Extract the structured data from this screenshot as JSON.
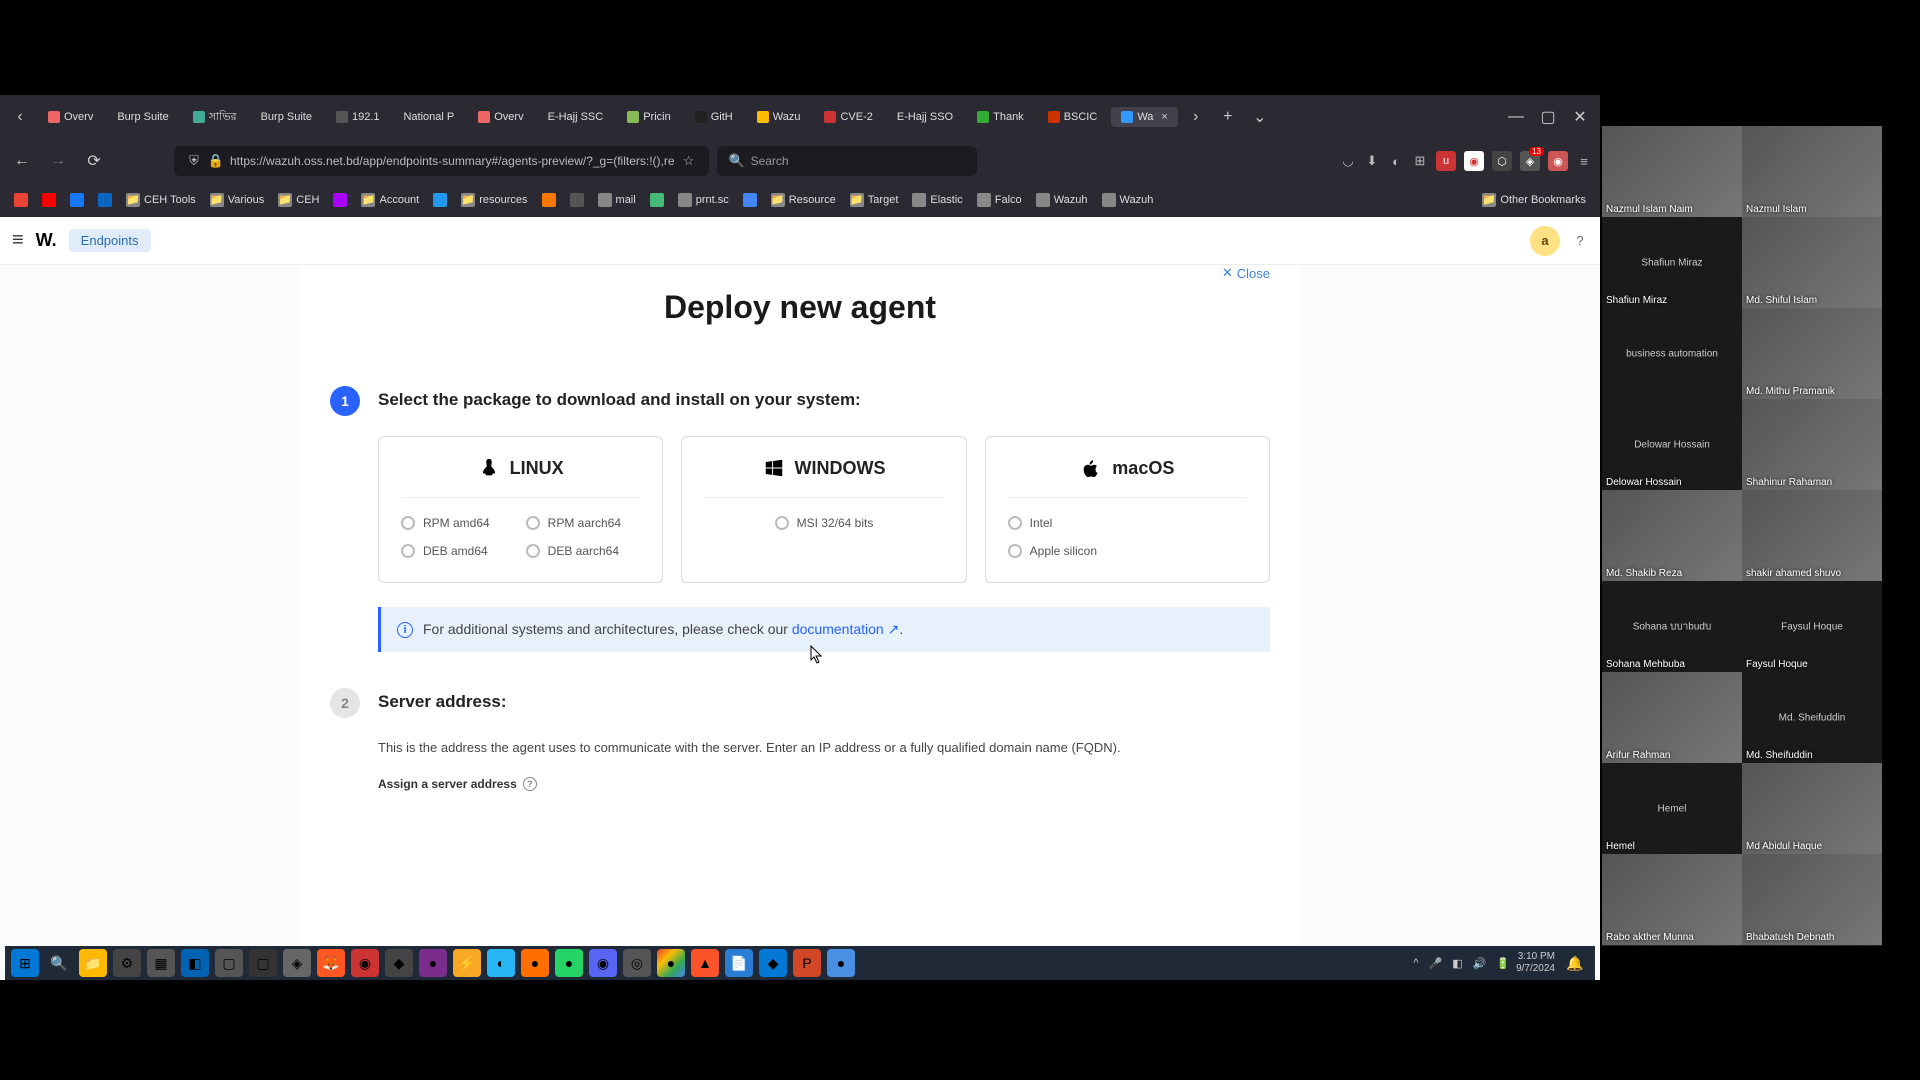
{
  "browser": {
    "tabs": [
      {
        "label": "Overv"
      },
      {
        "label": "Burp Suite"
      },
      {
        "label": "সাভির"
      },
      {
        "label": "Burp Suite"
      },
      {
        "label": "192.1"
      },
      {
        "label": "National P"
      },
      {
        "label": "Overv"
      },
      {
        "label": "E-Hajj SSC"
      },
      {
        "label": "Pricin"
      },
      {
        "label": "GitH"
      },
      {
        "label": "Wazu"
      },
      {
        "label": "CVE-2"
      },
      {
        "label": "E-Hajj SSO"
      },
      {
        "label": "Thank"
      },
      {
        "label": "BSCIC"
      },
      {
        "label": "Wa"
      }
    ],
    "url": "https://wazuh.oss.net.bd/app/endpoints-summary#/agents-preview/?_g=(filters:!(),re",
    "search_placeholder": "Search",
    "bookmarks": [
      "CEH Tools",
      "Various",
      "CEH",
      "Account",
      "resources",
      "mail",
      "prnt.sc",
      "Resource",
      "Target",
      "Elastic",
      "Falco",
      "Wazuh",
      "Wazuh"
    ],
    "other_bookmarks": "Other Bookmarks"
  },
  "app": {
    "nav": "Endpoints",
    "avatar_initial": "a",
    "logo": "W."
  },
  "wizard": {
    "close": "Close",
    "title": "Deploy new agent",
    "step1_num": "1",
    "step1_title": "Select the package to download and install on your system:",
    "linux": {
      "title": "LINUX",
      "opts": [
        "RPM amd64",
        "RPM aarch64",
        "DEB amd64",
        "DEB aarch64"
      ]
    },
    "windows": {
      "title": "WINDOWS",
      "opts": [
        "MSI 32/64 bits"
      ]
    },
    "macos": {
      "title": "macOS",
      "opts": [
        "Intel",
        "Apple silicon"
      ]
    },
    "info_text": "For additional systems and architectures, please check our ",
    "doc_link": "documentation",
    "step2_num": "2",
    "step2_title": "Server address:",
    "step2_desc": "This is the address the agent uses to communicate with the server. Enter an IP address or a fully qualified domain name (FQDN).",
    "assign_label": "Assign a server address"
  },
  "participants": [
    {
      "name": "Nazmul Islam Naim",
      "dark": false
    },
    {
      "name": "Nazmul Islam",
      "dark": false
    },
    {
      "name": "Shafiun Miraz",
      "dark": true,
      "label": "Shafiun Miraz"
    },
    {
      "name": "Md. Shiful Islam",
      "dark": false
    },
    {
      "name": "",
      "dark": true,
      "label": "business automation"
    },
    {
      "name": "Md. Mithu Pramanik",
      "dark": false
    },
    {
      "name": "Delowar Hossain",
      "dark": true,
      "label": "Delowar Hossain"
    },
    {
      "name": "Shahinur Rahaman",
      "dark": false
    },
    {
      "name": "Md. Shakib Reza",
      "dark": false
    },
    {
      "name": "shakir ahamed shuvo",
      "dark": false
    },
    {
      "name": "Sohana Mehbuba",
      "dark": true,
      "label": "Sohana บบาbudบ"
    },
    {
      "name": "Faysul Hoque",
      "dark": true,
      "label": "Faysul Hoque"
    },
    {
      "name": "Arifur Rahman",
      "dark": false
    },
    {
      "name": "Md. Sheifuddin",
      "dark": true,
      "label": "Md. Sheifuddin"
    },
    {
      "name": "Hemel",
      "dark": true,
      "label": "Hemel"
    },
    {
      "name": "Md Abidul Haque",
      "dark": false
    },
    {
      "name": "Rabo akther Munna",
      "dark": false
    },
    {
      "name": "Bhabatush Debnath",
      "dark": false
    }
  ],
  "taskbar": {
    "time": "3:10 PM",
    "date": "9/7/2024"
  },
  "ext_badge": "13"
}
